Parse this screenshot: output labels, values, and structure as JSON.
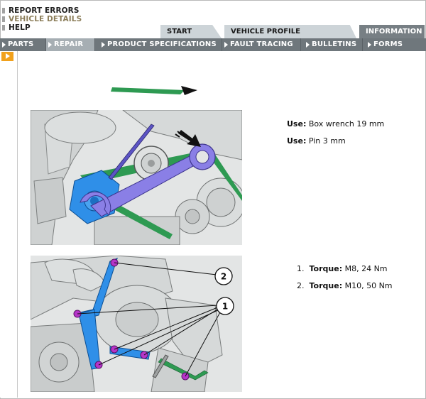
{
  "utility_menu": [
    "REPORT ERRORS",
    "VEHICLE DETAILS",
    "HELP"
  ],
  "tabs": {
    "start": "START",
    "vehicle_profile": "VEHICLE PROFILE",
    "information": "INFORMATION"
  },
  "nav": {
    "items": [
      "PARTS",
      "REPAIR",
      "PRODUCT SPECIFICATIONS",
      "FAULT TRACING",
      "BULLETINS",
      "FORMS"
    ],
    "active": "REPAIR"
  },
  "tools": [
    {
      "label": "Use:",
      "value": "Box wrench 19 mm"
    },
    {
      "label": "Use:",
      "value": "Pin 3 mm"
    }
  ],
  "torque": [
    {
      "num": "1.",
      "label": "Torque:",
      "value": "M8, 24 Nm"
    },
    {
      "num": "2.",
      "label": "Torque:",
      "value": "M10, 50 Nm"
    }
  ],
  "callouts": [
    "2",
    "1"
  ],
  "colors": {
    "nav_bg": "#6f777c",
    "nav_active": "#a6aeb3",
    "tab_inactive": "#cdd4d8",
    "tab_active": "#777f84",
    "side_button": "#f1a11c",
    "highlight_blue": "#2f8fe8",
    "tool_purple": "#8a7fe6",
    "belt_green": "#2e9a52",
    "bolt_purple": "#b534c8"
  },
  "icons": [
    "triangle-right-icon",
    "grip-icon"
  ]
}
